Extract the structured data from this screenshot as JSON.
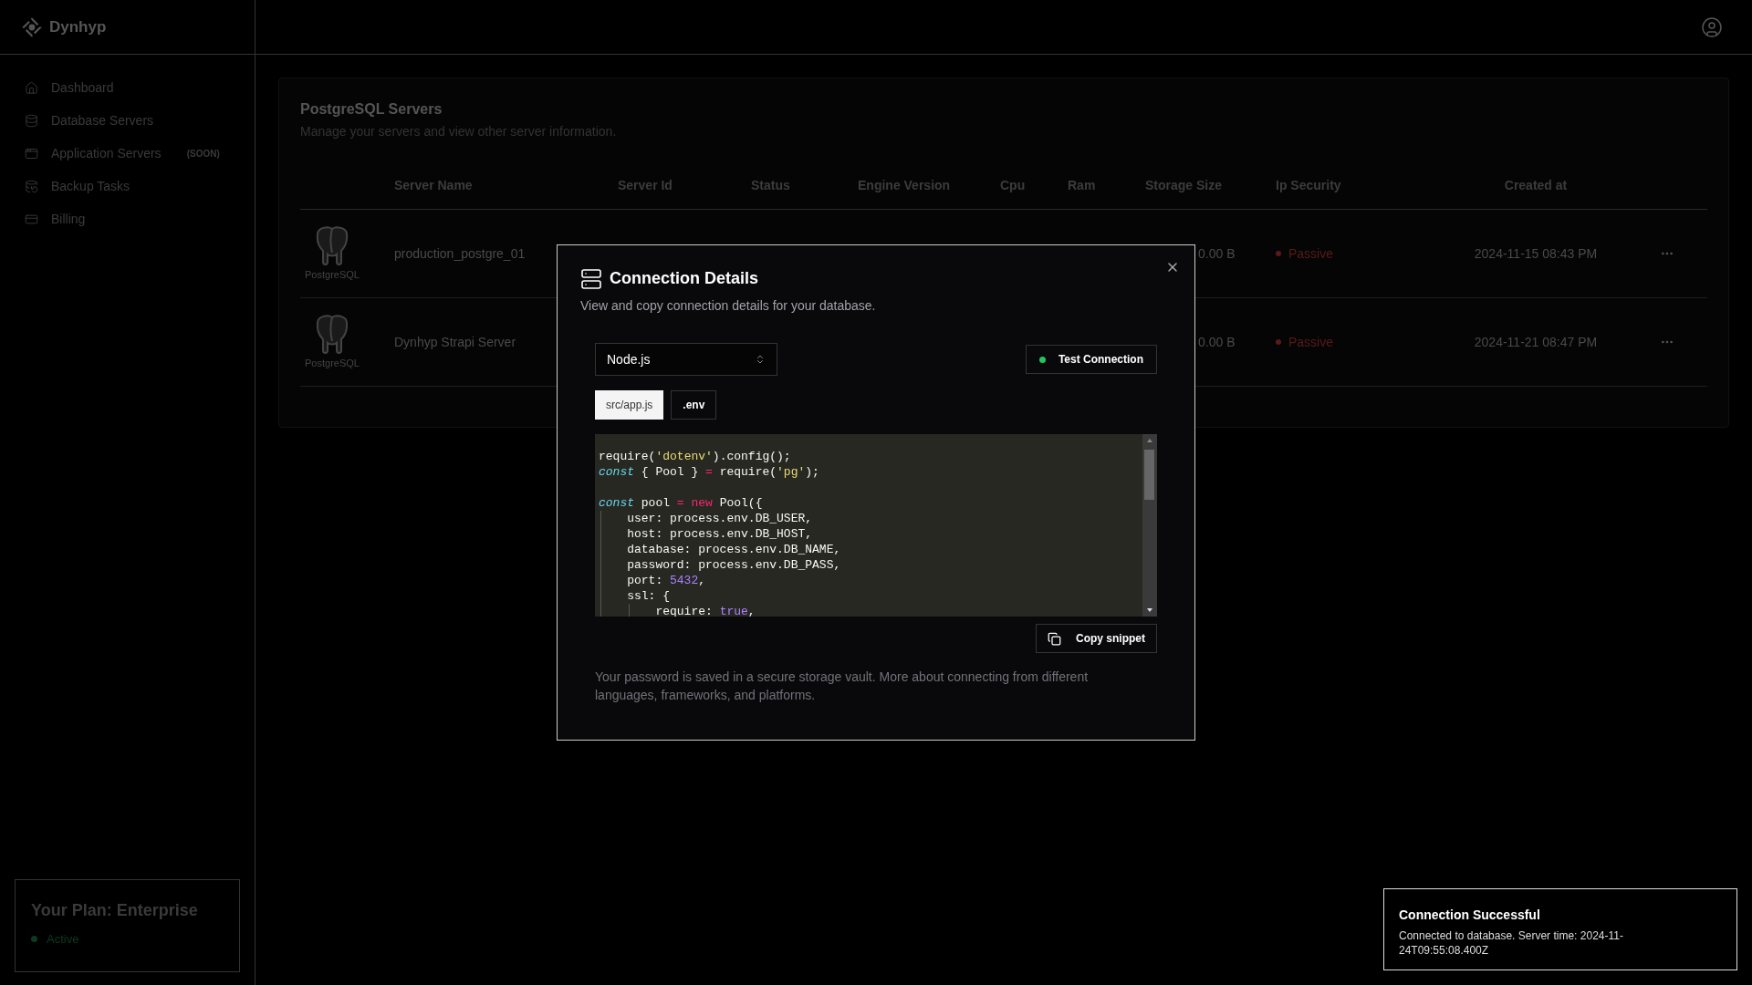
{
  "brand": {
    "name": "Dynhyp"
  },
  "sidebar": {
    "items": [
      {
        "label": "Dashboard"
      },
      {
        "label": "Database Servers"
      },
      {
        "label": "Application Servers",
        "badge": "(SOON)"
      },
      {
        "label": "Backup Tasks"
      },
      {
        "label": "Billing"
      }
    ],
    "plan": {
      "title": "Your Plan: Enterprise",
      "status": "Active",
      "active": true
    }
  },
  "panel": {
    "title": "PostgreSQL Servers",
    "subtitle": "Manage your servers and view other server information.",
    "columns": [
      "Server Name",
      "Server Id",
      "Status",
      "Engine Version",
      "Cpu",
      "Ram",
      "Storage Size",
      "Ip Security",
      "Created at"
    ],
    "rows": [
      {
        "logo_label": "PostgreSQL",
        "name": "production_postgre_01",
        "storage": "0.00 B",
        "ip_security": "Passive",
        "created_at": "2024-11-15 08:43 PM"
      },
      {
        "logo_label": "PostgreSQL",
        "name": "Dynhyp Strapi Server",
        "storage": "0.00 B",
        "ip_security": "Passive",
        "created_at": "2024-11-21 08:47 PM"
      }
    ]
  },
  "dialog": {
    "title": "Connection Details",
    "description": "View and copy connection details for your database.",
    "language": "Node.js",
    "test_button": "Test Connection",
    "connected": true,
    "tabs": [
      {
        "label": "src/app.js",
        "selected": true
      },
      {
        "label": ".env",
        "selected": false
      }
    ],
    "code": [
      {
        "kind": "code",
        "tokens": [
          {
            "t": "require(",
            "kind": "plain"
          },
          {
            "t": "'dotenv'",
            "kind": "string"
          },
          {
            "t": ").config();",
            "kind": "plain"
          }
        ]
      },
      {
        "kind": "code",
        "tokens": [
          {
            "t": "const",
            "kind": "keyword"
          },
          {
            "t": " { Pool } ",
            "kind": "plain"
          },
          {
            "t": "=",
            "kind": "operator"
          },
          {
            "t": " require(",
            "kind": "plain"
          },
          {
            "t": "'pg'",
            "kind": "string"
          },
          {
            "t": ");",
            "kind": "plain"
          }
        ]
      },
      {
        "kind": "blank"
      },
      {
        "kind": "code",
        "tokens": [
          {
            "t": "const",
            "kind": "keyword"
          },
          {
            "t": " pool ",
            "kind": "plain"
          },
          {
            "t": "=",
            "kind": "operator"
          },
          {
            "t": " new",
            "kind": "operator"
          },
          {
            "t": " Pool({",
            "kind": "plain"
          }
        ]
      },
      {
        "kind": "code",
        "tokens": [
          {
            "t": "    user: process.env.DB_USER,",
            "kind": "plain"
          }
        ]
      },
      {
        "kind": "code",
        "tokens": [
          {
            "t": "    host: process.env.DB_HOST,",
            "kind": "plain"
          }
        ]
      },
      {
        "kind": "code",
        "tokens": [
          {
            "t": "    database: process.env.DB_NAME,",
            "kind": "plain"
          }
        ]
      },
      {
        "kind": "code",
        "tokens": [
          {
            "t": "    password: process.env.DB_PASS,",
            "kind": "plain"
          }
        ]
      },
      {
        "kind": "code",
        "tokens": [
          {
            "t": "    port: ",
            "kind": "plain"
          },
          {
            "t": "5432",
            "kind": "number"
          },
          {
            "t": ",",
            "kind": "plain"
          }
        ]
      },
      {
        "kind": "code",
        "tokens": [
          {
            "t": "    ssl: {",
            "kind": "plain"
          }
        ]
      },
      {
        "kind": "code",
        "tokens": [
          {
            "t": "        require: ",
            "kind": "plain"
          },
          {
            "t": "true",
            "kind": "number"
          },
          {
            "t": ",",
            "kind": "plain"
          }
        ]
      }
    ],
    "copy_button": "Copy snippet",
    "footer": "Your password is saved in a secure storage vault. More about connecting from different languages, frameworks, and platforms."
  },
  "toast": {
    "title": "Connection Successful",
    "message": "Connected to database. Server time: 2024-11-24T09:55:08.400Z"
  }
}
